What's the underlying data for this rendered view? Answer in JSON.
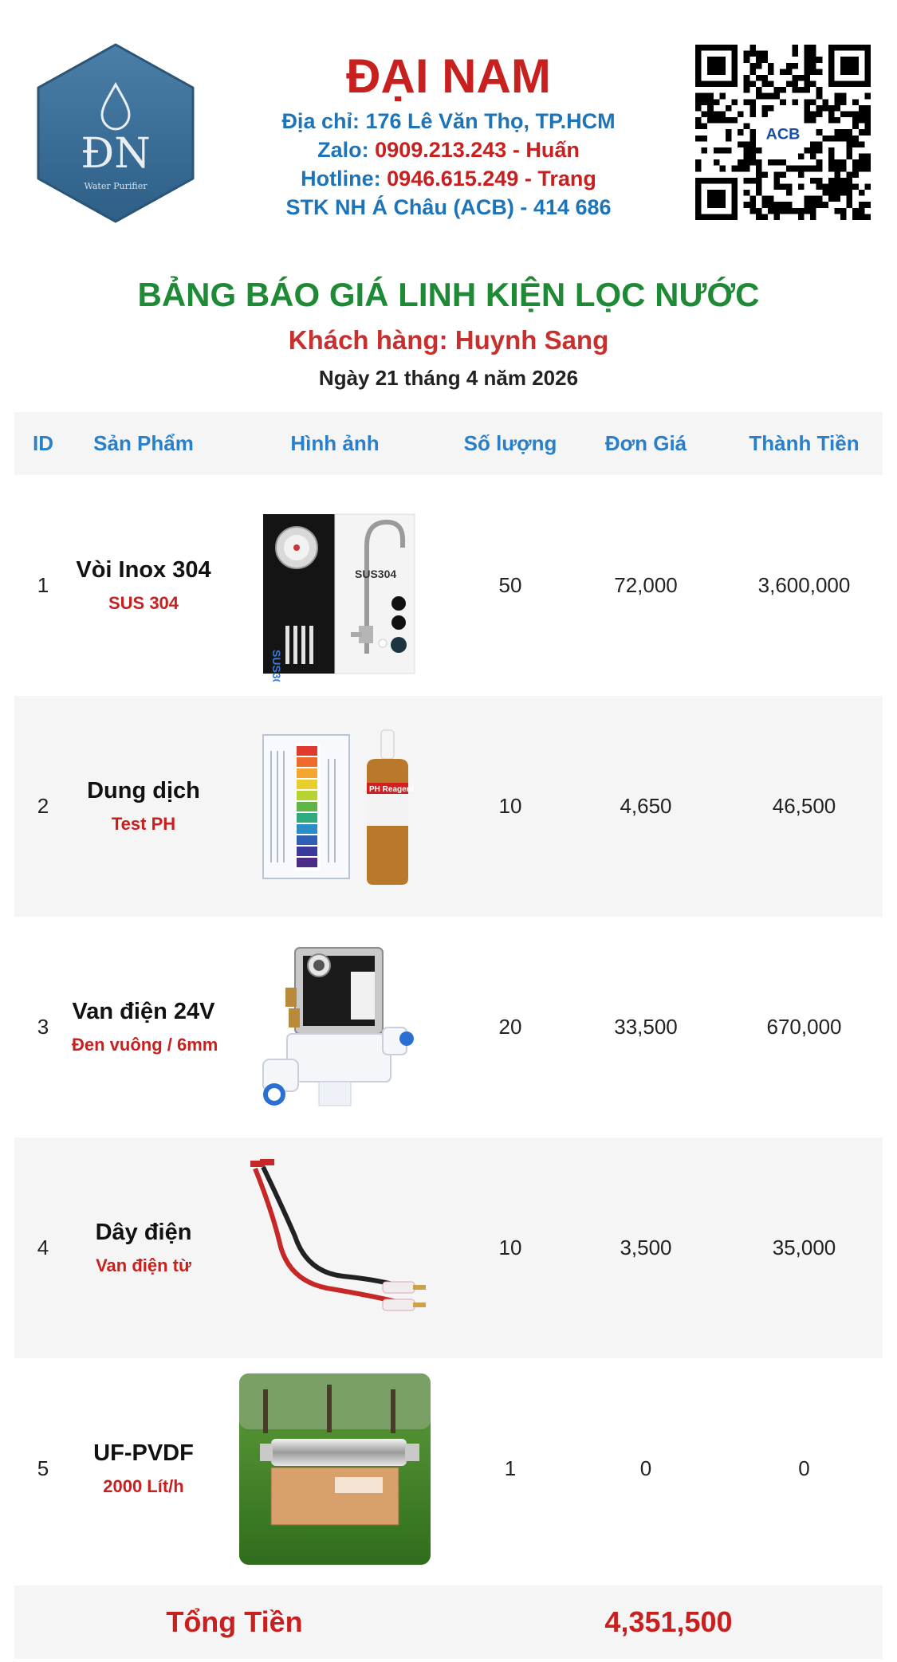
{
  "header": {
    "logo_initials": "ĐN",
    "logo_tagline": "Water Purifier",
    "company_name": "ĐẠI NAM",
    "address_label": "Địa chỉ:",
    "address_value": "176 Lê Văn Thọ, TP.HCM",
    "zalo_label": "Zalo:",
    "zalo_number": "0909.213.243",
    "zalo_name": "- Huấn",
    "hotline_label": "Hotline:",
    "hotline_number": "0946.615.249",
    "hotline_name": "- Trang",
    "bank_label": "STK NH Á Châu (ACB) -",
    "bank_account": "414 686",
    "qr_center_text": "ACB"
  },
  "document": {
    "title": "BẢNG BÁO GIÁ LINH KIỆN LỌC NƯỚC",
    "customer": "Khách hàng: Huynh Sang",
    "date": "Ngày 21 tháng 4 năm 2026"
  },
  "table": {
    "headers": [
      "ID",
      "Sản Phẩm",
      "Hình ảnh",
      "Số lượng",
      "Đơn Giá",
      "Thành Tiền"
    ],
    "rows": [
      {
        "id": "1",
        "name": "Vòi Inox 304",
        "sub": "SUS 304",
        "image": "faucet-icon",
        "img_text": "SUS304",
        "qty": "50",
        "price": "72,000",
        "total": "3,600,000"
      },
      {
        "id": "2",
        "name": "Dung dịch",
        "sub": "Test PH",
        "image": "ph-test-kit-icon",
        "img_text": "PH Reagent",
        "qty": "10",
        "price": "4,650",
        "total": "46,500"
      },
      {
        "id": "3",
        "name": "Van điện 24V",
        "sub": "Đen vuông / 6mm",
        "image": "solenoid-valve-icon",
        "qty": "20",
        "price": "33,500",
        "total": "670,000"
      },
      {
        "id": "4",
        "name": "Dây điện",
        "sub": "Van điện từ",
        "image": "wire-icon",
        "qty": "10",
        "price": "3,500",
        "total": "35,000"
      },
      {
        "id": "5",
        "name": "UF-PVDF",
        "sub": "2000 Lít/h",
        "image": "uf-filter-icon",
        "qty": "1",
        "price": "0",
        "total": "0"
      }
    ],
    "total_label": "Tổng Tiền",
    "total_value": "4,351,500"
  },
  "colors": {
    "red": "#c8201f",
    "blue": "#1e74b8",
    "green": "#1e8a35",
    "row_bg": "#f5f5f5"
  }
}
